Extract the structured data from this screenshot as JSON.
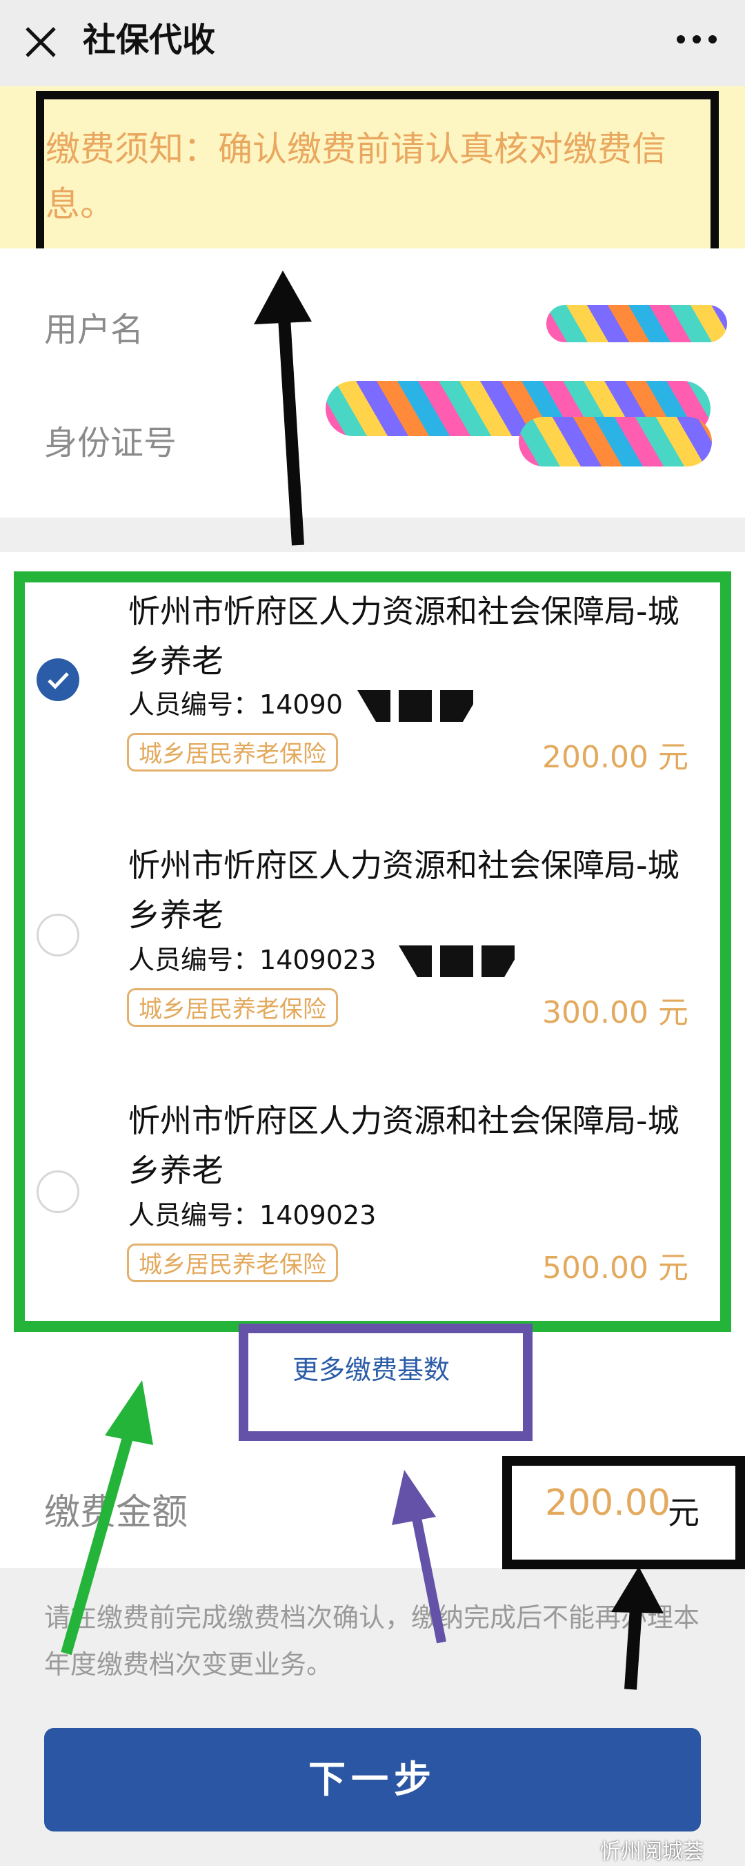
{
  "header": {
    "title": "社保代收",
    "close_icon": "close-icon",
    "more_icon": "more-dots-icon"
  },
  "notice": {
    "text": "缴费须知：确认缴费前请认真核对缴费信息。"
  },
  "info": {
    "username_label": "用户名",
    "id_label": "身份证号"
  },
  "items": [
    {
      "name": "忻州市忻府区人力资源和社会保障局-城乡养老",
      "id_label": "人员编号：",
      "id_value": "14090",
      "tag": "城乡居民养老保险",
      "amount": "200.00 元",
      "selected": true
    },
    {
      "name": "忻州市忻府区人力资源和社会保障局-城乡养老",
      "id_label": "人员编号：",
      "id_value": "1409023",
      "tag": "城乡居民养老保险",
      "amount": "300.00 元",
      "selected": false
    },
    {
      "name": "忻州市忻府区人力资源和社会保障局-城乡养老",
      "id_label": "人员编号：",
      "id_value": "1409023",
      "tag": "城乡居民养老保险",
      "amount": "500.00 元",
      "selected": false
    }
  ],
  "more_base_label": "更多缴费基数",
  "amount": {
    "label": "缴费金额",
    "value": "200.00",
    "unit": "元"
  },
  "tip": "请在缴费前完成缴费档次确认，缴纳完成后不能再办理本年度缴费档次变更业务。",
  "next_button": "下一步",
  "watermark": "忻州阅城荟",
  "colors": {
    "accent_blue": "#2a56a3",
    "notice_bg": "#fdf6c3",
    "amount_orange": "#e3a95d",
    "annot_green": "#25b43a",
    "annot_purple": "#6452a8"
  }
}
